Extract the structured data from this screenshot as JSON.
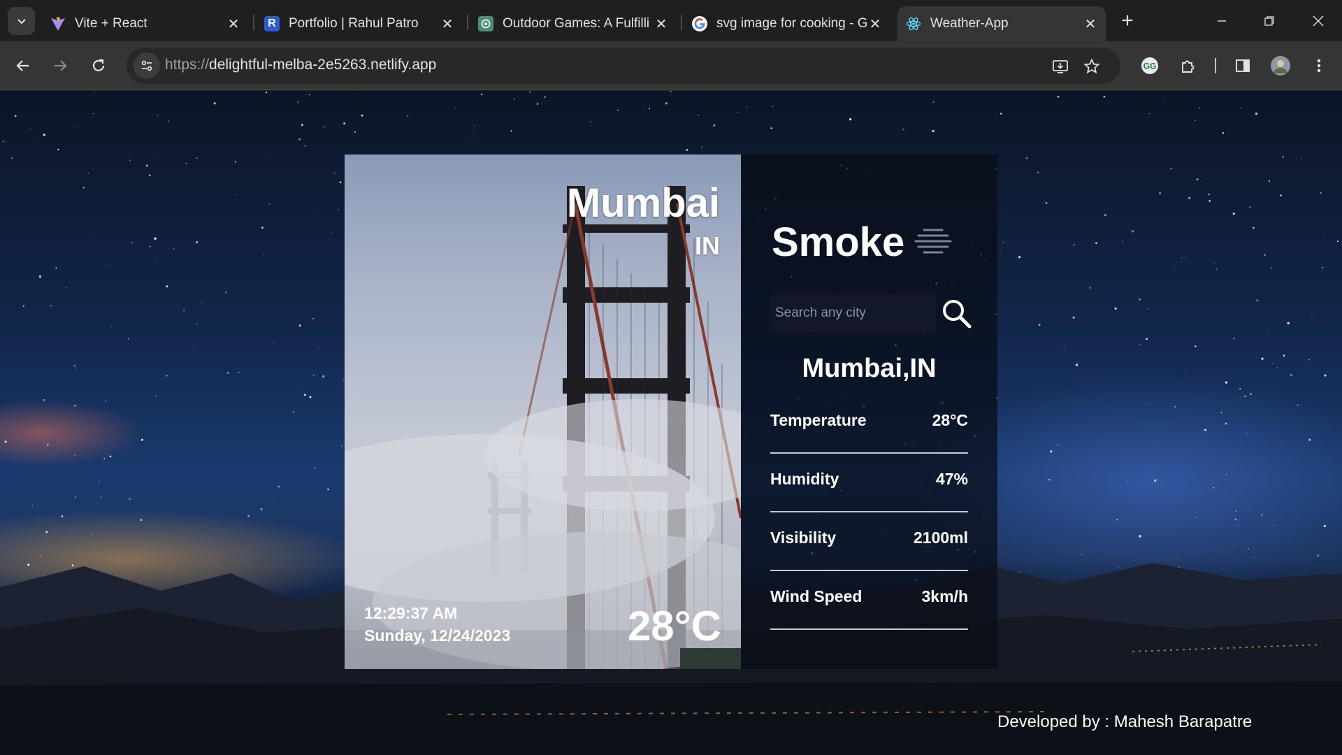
{
  "browser": {
    "tabs": [
      {
        "title": "Vite + React",
        "icon": "vite-icon"
      },
      {
        "title": "Portfolio | Rahul Patro",
        "icon": "letter-r-icon"
      },
      {
        "title": "Outdoor Games: A Fulfilli",
        "icon": "chatgpt-icon"
      },
      {
        "title": "svg image for cooking - G",
        "icon": "google-icon"
      },
      {
        "title": "Weather-App",
        "icon": "react-icon",
        "active": true
      }
    ],
    "url_scheme": "https://",
    "url_host": "delightful-melba-2e5263.netlify.app"
  },
  "weather": {
    "city": "Mumbai",
    "country": "IN",
    "time": "12:29:37 AM",
    "date": "Sunday, 12/24/2023",
    "temperature_display": "28°C",
    "condition": "Smoke",
    "condition_icon": "smoke-haze-icon",
    "search_placeholder": "Search any city",
    "location_label": "Mumbai,IN",
    "stats": [
      {
        "label": "Temperature",
        "value": "28°C"
      },
      {
        "label": "Humidity",
        "value": "47%"
      },
      {
        "label": "Visibility",
        "value": "2100ml"
      },
      {
        "label": "Wind Speed",
        "value": "3km/h"
      }
    ]
  },
  "footer": {
    "credit": "Developed by : Mahesh Barapatre"
  }
}
